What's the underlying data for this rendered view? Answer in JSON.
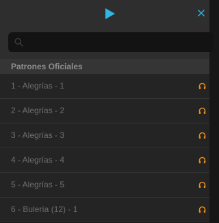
{
  "toolbar": {
    "play_icon": "play-icon",
    "close_icon": "close-icon",
    "accent_color": "#2fb6e6"
  },
  "search": {
    "value": "",
    "placeholder": "",
    "icon": "search-icon"
  },
  "section": {
    "title": "Patrones Oficiales"
  },
  "patterns": [
    {
      "label": "1 - Alegrías - 1",
      "icon": "headphones-icon"
    },
    {
      "label": "2 - Alegrías - 2",
      "icon": "headphones-icon"
    },
    {
      "label": "3 - Alegrías - 3",
      "icon": "headphones-icon"
    },
    {
      "label": "4 - Alegrías - 4",
      "icon": "headphones-icon"
    },
    {
      "label": "5 - Alegrías - 5",
      "icon": "headphones-icon"
    },
    {
      "label": "6 - Bulería (12) - 1",
      "icon": "headphones-icon"
    }
  ],
  "colors": {
    "headphones": "#e88a1a"
  }
}
